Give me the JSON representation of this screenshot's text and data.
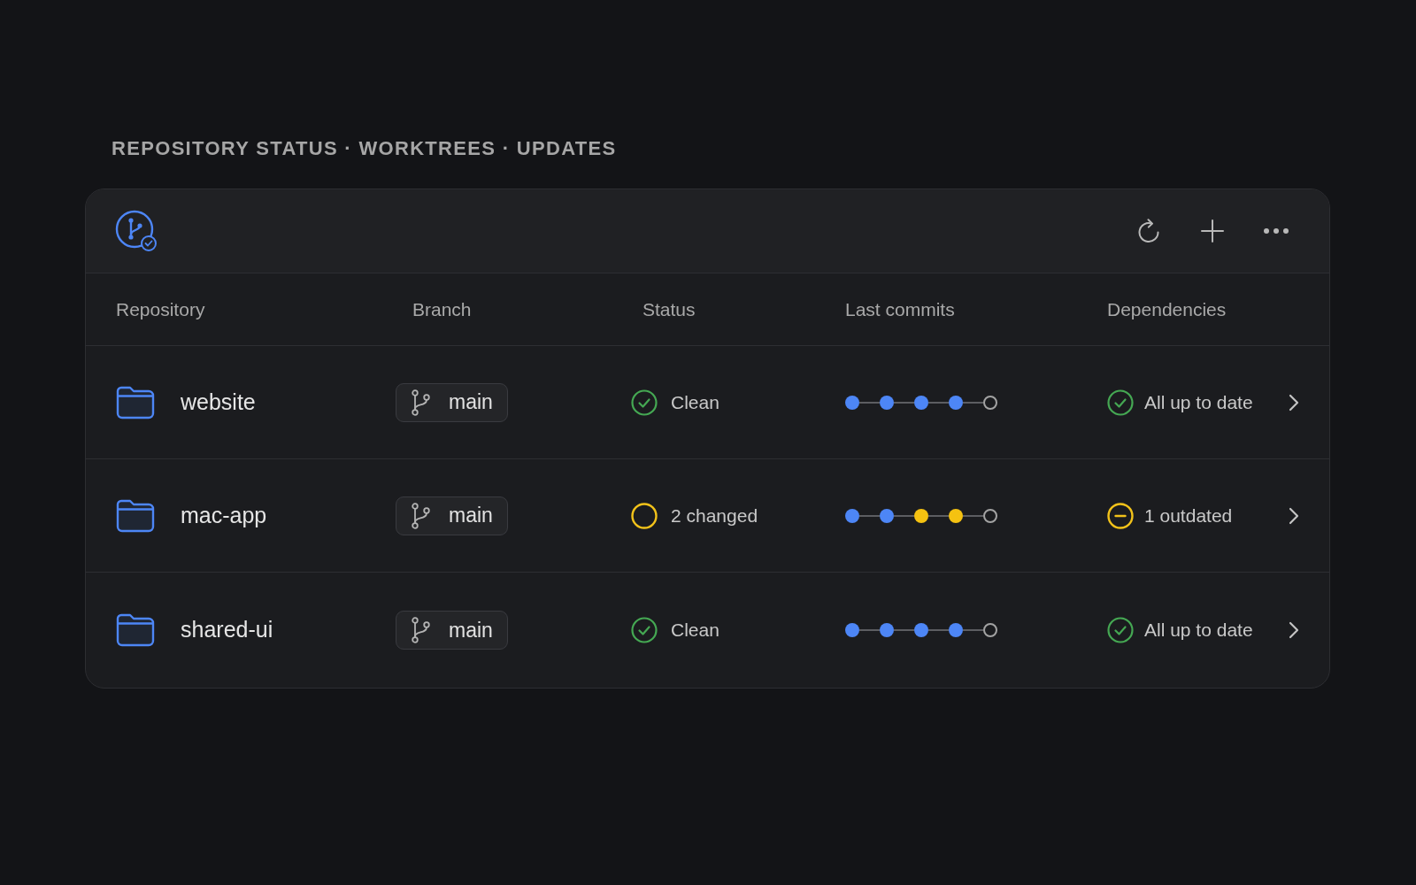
{
  "title": "REPOSITORY STATUS · WORKTREES · UPDATES",
  "table": {
    "columns": [
      "Repository",
      "Branch",
      "Status",
      "Last commits",
      "Dependencies"
    ],
    "rows": [
      {
        "name": "website",
        "branch": "main",
        "status": {
          "kind": "clean",
          "label": "Clean"
        },
        "commits": [
          {
            "kind": "commit",
            "color": "#4d86f6"
          },
          {
            "kind": "commit",
            "color": "#4d86f6"
          },
          {
            "kind": "commit",
            "color": "#4d86f6"
          },
          {
            "kind": "commit",
            "color": "#4d86f6"
          },
          {
            "kind": "pending",
            "color": "#a3a3a3"
          }
        ],
        "dependencies": {
          "kind": "ok",
          "label": "All up to date"
        }
      },
      {
        "name": "mac-app",
        "branch": "main",
        "status": {
          "kind": "changed",
          "label": "2 changed"
        },
        "commits": [
          {
            "kind": "commit",
            "color": "#4d86f6"
          },
          {
            "kind": "commit",
            "color": "#4d86f6"
          },
          {
            "kind": "commit",
            "color": "#f5c211"
          },
          {
            "kind": "commit",
            "color": "#f5c211"
          },
          {
            "kind": "pending",
            "color": "#a3a3a3"
          }
        ],
        "dependencies": {
          "kind": "outdated",
          "label": "1 outdated"
        }
      },
      {
        "name": "shared-ui",
        "branch": "main",
        "status": {
          "kind": "clean",
          "label": "Clean"
        },
        "commits": [
          {
            "kind": "commit",
            "color": "#4d86f6"
          },
          {
            "kind": "commit",
            "color": "#4d86f6"
          },
          {
            "kind": "commit",
            "color": "#4d86f6"
          },
          {
            "kind": "commit",
            "color": "#4d86f6"
          },
          {
            "kind": "pending",
            "color": "#a3a3a3"
          }
        ],
        "dependencies": {
          "kind": "ok",
          "label": "All up to date"
        }
      }
    ]
  }
}
